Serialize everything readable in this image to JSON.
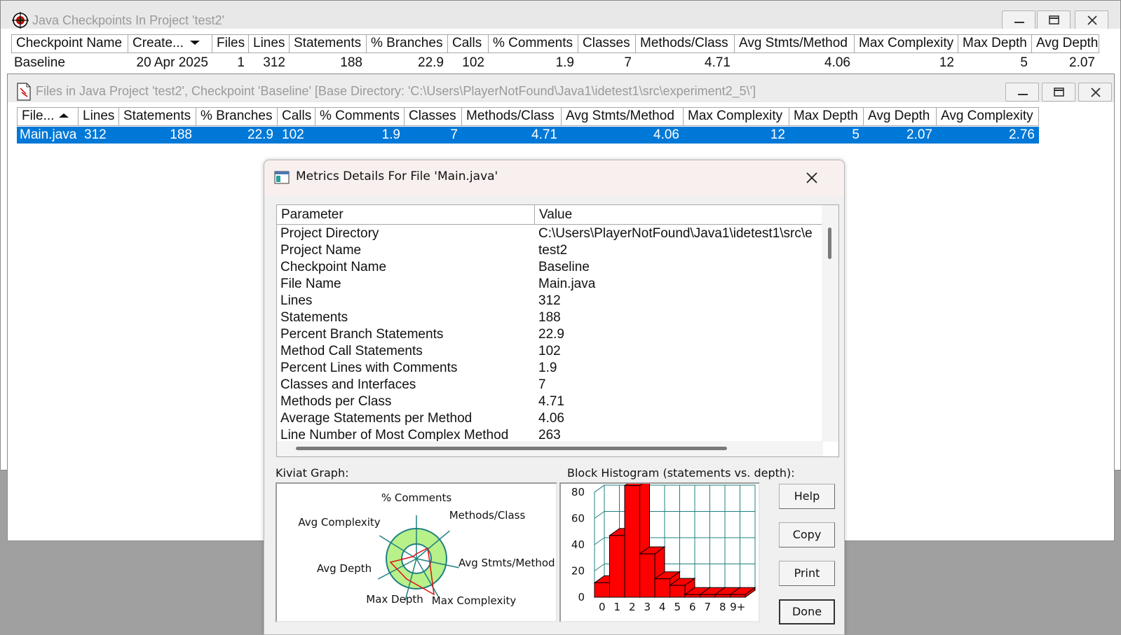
{
  "checkpoints_window": {
    "title": "Java Checkpoints In Project 'test2'",
    "columns": [
      "Checkpoint Name",
      "Create...",
      "Files",
      "Lines",
      "Statements",
      "% Branches",
      "Calls",
      "% Comments",
      "Classes",
      "Methods/Class",
      "Avg Stmts/Method",
      "Max Complexity",
      "Max Depth",
      "Avg Depth"
    ],
    "rows": [
      {
        "name": "Baseline",
        "created": "20 Apr 2025",
        "files": "1",
        "lines": "312",
        "statements": "188",
        "branches": "22.9",
        "calls": "102",
        "comments": "1.9",
        "classes": "7",
        "methods_per_class": "4.71",
        "avg_stmts": "4.06",
        "max_complexity": "12",
        "max_depth": "5",
        "avg_depth": "2.07"
      }
    ]
  },
  "files_window": {
    "title": "Files in Java Project 'test2', Checkpoint 'Baseline'  [Base Directory: 'C:\\Users\\PlayerNotFound\\Java1\\idetest1\\src\\experiment2_5\\']",
    "columns": [
      "File...",
      "Lines",
      "Statements",
      "% Branches",
      "Calls",
      "% Comments",
      "Classes",
      "Methods/Class",
      "Avg Stmts/Method",
      "Max Complexity",
      "Max Depth",
      "Avg Depth",
      "Avg Complexity"
    ],
    "rows": [
      {
        "file": "Main.java",
        "lines": "312",
        "statements": "188",
        "branches": "22.9",
        "calls": "102",
        "comments": "1.9",
        "classes": "7",
        "methods_per_class": "4.71",
        "avg_stmts": "4.06",
        "max_complexity": "12",
        "max_depth": "5",
        "avg_depth": "2.07",
        "avg_complexity": "2.76"
      }
    ]
  },
  "dialog": {
    "title": "Metrics Details For File 'Main.java'",
    "table": {
      "headers": [
        "Parameter",
        "Value"
      ],
      "rows": [
        {
          "param": "Project Directory",
          "value": "C:\\Users\\PlayerNotFound\\Java1\\idetest1\\src\\e"
        },
        {
          "param": "Project Name",
          "value": "test2"
        },
        {
          "param": "Checkpoint Name",
          "value": "Baseline"
        },
        {
          "param": "File Name",
          "value": "Main.java"
        },
        {
          "param": "Lines",
          "value": "312"
        },
        {
          "param": "Statements",
          "value": "188"
        },
        {
          "param": "Percent Branch Statements",
          "value": "22.9"
        },
        {
          "param": "Method Call Statements",
          "value": "102"
        },
        {
          "param": "Percent Lines with Comments",
          "value": "1.9"
        },
        {
          "param": "Classes and Interfaces",
          "value": "7"
        },
        {
          "param": "Methods per Class",
          "value": "4.71"
        },
        {
          "param": "Average Statements per Method",
          "value": "4.06"
        },
        {
          "param": "Line Number of Most Complex Method",
          "value": "263"
        }
      ]
    },
    "kiviat_label": "Kiviat Graph:",
    "kiviat_axes": [
      "% Comments",
      "Methods/Class",
      "Avg Stmts/Method",
      "Max Complexity",
      "Max Depth",
      "Avg Depth",
      "Avg Complexity"
    ],
    "histogram_label": "Block Histogram (statements vs. depth):",
    "histogram": {
      "x": [
        "0",
        "1",
        "2",
        "3",
        "4",
        "5",
        "6",
        "7",
        "8",
        "9+"
      ],
      "y_ticks": [
        "80",
        "60",
        "40",
        "20",
        "0"
      ],
      "values": [
        11,
        47,
        85,
        33,
        14,
        9,
        2,
        2,
        2,
        2
      ],
      "ylim": [
        0,
        80
      ],
      "bar_color": "#ff0000"
    },
    "buttons": {
      "help": "Help",
      "copy": "Copy",
      "print": "Print",
      "done": "Done"
    }
  }
}
